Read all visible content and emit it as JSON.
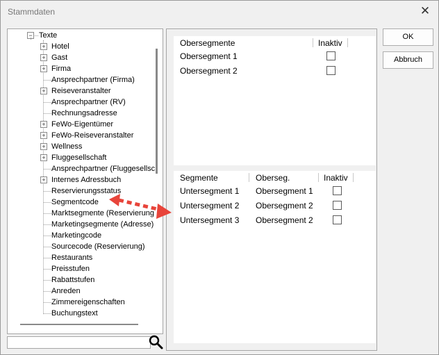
{
  "window": {
    "title": "Stammdaten",
    "close_glyph": "✕"
  },
  "tree": {
    "root": {
      "label": "Texte",
      "expander": "−"
    },
    "items": [
      {
        "label": "Hotel",
        "expandable": true
      },
      {
        "label": "Gast",
        "expandable": true
      },
      {
        "label": "Firma",
        "expandable": true
      },
      {
        "label": "Ansprechpartner (Firma)",
        "expandable": false
      },
      {
        "label": "Reiseveranstalter",
        "expandable": true
      },
      {
        "label": "Ansprechpartner (RV)",
        "expandable": false
      },
      {
        "label": "Rechnungsadresse",
        "expandable": false
      },
      {
        "label": "FeWo-Eigentümer",
        "expandable": true
      },
      {
        "label": "FeWo-Reiseveranstalter",
        "expandable": true
      },
      {
        "label": "Wellness",
        "expandable": true
      },
      {
        "label": "Fluggesellschaft",
        "expandable": true
      },
      {
        "label": "Ansprechpartner (Fluggesellsc",
        "expandable": false
      },
      {
        "label": "Internes Adressbuch",
        "expandable": true
      },
      {
        "label": "Reservierungsstatus",
        "expandable": false
      },
      {
        "label": "Segmentcode",
        "expandable": false
      },
      {
        "label": "Marktsegmente (Reservierung",
        "expandable": false
      },
      {
        "label": "Marketingsegmente (Adresse)",
        "expandable": false
      },
      {
        "label": "Marketingcode",
        "expandable": false
      },
      {
        "label": "Sourcecode (Reservierung)",
        "expandable": false
      },
      {
        "label": "Restaurants",
        "expandable": false
      },
      {
        "label": "Preisstufen",
        "expandable": false
      },
      {
        "label": "Rabattstufen",
        "expandable": false
      },
      {
        "label": "Anreden",
        "expandable": false
      },
      {
        "label": "Zimmereigenschaften",
        "expandable": false
      },
      {
        "label": "Buchungstext",
        "expandable": false
      }
    ]
  },
  "search": {
    "value": "",
    "icon": "search-icon"
  },
  "obersegmente": {
    "headers": {
      "name": "Obersegmente",
      "inaktiv": "Inaktiv"
    },
    "rows": [
      {
        "name": "Obersegment 1",
        "inaktiv": false
      },
      {
        "name": "Obersegment 2",
        "inaktiv": false
      }
    ]
  },
  "segmente": {
    "headers": {
      "name": "Segmente",
      "oberseg": "Oberseg.",
      "inaktiv": "Inaktiv"
    },
    "rows": [
      {
        "name": "Untersegment 1",
        "oberseg": "Obersegment 1",
        "inaktiv": false
      },
      {
        "name": "Untersegment 2",
        "oberseg": "Obersegment 2",
        "inaktiv": false
      },
      {
        "name": "Untersegment 3",
        "oberseg": "Obersegment 2",
        "inaktiv": false
      }
    ]
  },
  "buttons": {
    "ok": "OK",
    "abbruch": "Abbruch"
  },
  "annotation": {
    "arrow_color": "#e8443a"
  }
}
